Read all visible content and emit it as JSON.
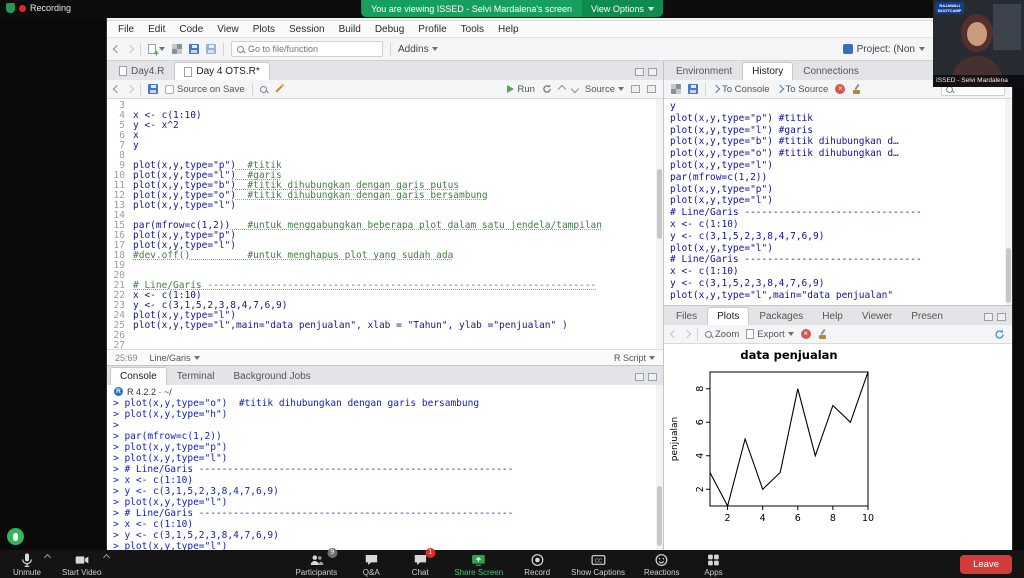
{
  "zoom": {
    "recording": "Recording",
    "banner_text": "You are viewing ISSED - Selvi Mardalena's screen",
    "view_options": "View Options",
    "view": "View",
    "webcam": {
      "label": "ISSED - Selvi Mardalena",
      "logo_line1": "RAJAWALI",
      "logo_line2": "BOOTCAMP"
    },
    "toolbar": {
      "items": [
        {
          "id": "unmute",
          "label": "Unmute",
          "icon": "mic",
          "group": "left",
          "menu_caret": true,
          "badge": ""
        },
        {
          "id": "start-video",
          "label": "Start Video",
          "icon": "video",
          "group": "left",
          "menu_caret": true,
          "badge": ""
        },
        {
          "id": "participants",
          "label": "Participants",
          "icon": "participants",
          "group": "center",
          "badge": "9"
        },
        {
          "id": "qa",
          "label": "Q&A",
          "icon": "qa",
          "group": "center",
          "badge": ""
        },
        {
          "id": "chat",
          "label": "Chat",
          "icon": "chat",
          "group": "center",
          "badge": "1"
        },
        {
          "id": "share-screen",
          "label": "Share Screen",
          "icon": "share",
          "group": "center",
          "accent": true,
          "badge": ""
        },
        {
          "id": "record",
          "label": "Record",
          "icon": "record",
          "group": "center",
          "badge": ""
        },
        {
          "id": "show-captions",
          "label": "Show Captions",
          "icon": "cc",
          "group": "center",
          "badge": ""
        },
        {
          "id": "reactions",
          "label": "Reactions",
          "icon": "reactions",
          "group": "center",
          "badge": ""
        },
        {
          "id": "apps",
          "label": "Apps",
          "icon": "apps",
          "group": "center",
          "badge": ""
        }
      ],
      "leave": "Leave"
    }
  },
  "rstudio": {
    "title": "RStudio",
    "menu": [
      "File",
      "Edit",
      "Code",
      "View",
      "Plots",
      "Session",
      "Build",
      "Debug",
      "Profile",
      "Tools",
      "Help"
    ],
    "toolbar": {
      "goto": "Go to file/function",
      "addins": "Addins",
      "project": "Project: (Non"
    },
    "source": {
      "tabs": [
        {
          "label": "Day4.R",
          "active": false
        },
        {
          "label": "Day 4 OTS.R*",
          "active": true
        }
      ],
      "source_on_save": "Source on Save",
      "run": "Run",
      "source_btn": "Source",
      "status_left": "25:69",
      "status_scope": "Line/Garis",
      "status_type": "R Script",
      "lines": [
        {
          "n": 3,
          "segs": []
        },
        {
          "n": 4,
          "segs": [
            {
              "t": "code",
              "s": "x <- c(1:10)"
            }
          ]
        },
        {
          "n": 5,
          "segs": [
            {
              "t": "code",
              "s": "y <- x^2"
            }
          ]
        },
        {
          "n": 6,
          "segs": [
            {
              "t": "code",
              "s": "x"
            }
          ]
        },
        {
          "n": 7,
          "segs": [
            {
              "t": "code",
              "s": "y"
            }
          ]
        },
        {
          "n": 8,
          "segs": []
        },
        {
          "n": 9,
          "segs": [
            {
              "t": "code",
              "s": "plot(x,y,type=\"p\")"
            },
            {
              "t": "comment",
              "s": "  #titik"
            }
          ]
        },
        {
          "n": 10,
          "segs": [
            {
              "t": "code",
              "s": "plot(x,y,type=\"l\")"
            },
            {
              "t": "comment",
              "s": "  #garis"
            }
          ]
        },
        {
          "n": 11,
          "segs": [
            {
              "t": "code",
              "s": "plot(x,y,type=\"b\")"
            },
            {
              "t": "comment",
              "s": "  #titik dihubungkan dengan garis putus"
            }
          ]
        },
        {
          "n": 12,
          "segs": [
            {
              "t": "code",
              "s": "plot(x,y,type=\"o\")"
            },
            {
              "t": "comment",
              "s": "  #titik dihubungkan dengan garis bersambung"
            }
          ]
        },
        {
          "n": 13,
          "segs": [
            {
              "t": "code",
              "s": "plot(x,y,type=\"l\")"
            }
          ]
        },
        {
          "n": 14,
          "segs": []
        },
        {
          "n": 15,
          "segs": [
            {
              "t": "code",
              "s": "par(mfrow=c(1,2))"
            },
            {
              "t": "comment",
              "s": "   #untuk menggabungkan beberapa plot dalam satu jendela/tampilan"
            }
          ]
        },
        {
          "n": 16,
          "segs": [
            {
              "t": "code",
              "s": "plot(x,y,type=\"p\")"
            }
          ]
        },
        {
          "n": 17,
          "segs": [
            {
              "t": "code",
              "s": "plot(x,y,type=\"l\")"
            }
          ]
        },
        {
          "n": 18,
          "segs": [
            {
              "t": "comment",
              "s": "#dev.off()          #untuk menghapus plot yang sudah ada"
            }
          ]
        },
        {
          "n": 19,
          "segs": []
        },
        {
          "n": 20,
          "segs": []
        },
        {
          "n": 21,
          "segs": [
            {
              "t": "comment",
              "s": "# Line/Garis --------------------------------------------------------------------"
            }
          ]
        },
        {
          "n": 22,
          "segs": [
            {
              "t": "code",
              "s": "x <- c(1:10)"
            }
          ]
        },
        {
          "n": 23,
          "segs": [
            {
              "t": "code",
              "s": "y <- c(3,1,5,2,3,8,4,7,6,9)"
            }
          ]
        },
        {
          "n": 24,
          "segs": [
            {
              "t": "code",
              "s": "plot(x,y,type=\"l\")"
            }
          ]
        },
        {
          "n": 25,
          "segs": [
            {
              "t": "code",
              "s": "plot(x,y,type=\"l\",main=\"data penjualan\", xlab = \"Tahun\", ylab =\"penjualan\" )"
            }
          ]
        },
        {
          "n": 26,
          "segs": []
        },
        {
          "n": 27,
          "segs": []
        }
      ]
    },
    "console": {
      "tabs": [
        {
          "label": "Console",
          "active": true
        },
        {
          "label": "Terminal",
          "active": false
        },
        {
          "label": "Background Jobs",
          "active": false
        }
      ],
      "header": "R 4.2.2 · ~/",
      "lines": [
        "> plot(x,y,type=\"o\")  #titik dihubungkan dengan garis bersambung",
        "> plot(x,y,type=\"h\")",
        ">",
        "> par(mfrow=c(1,2))",
        "> plot(x,y,type=\"p\")",
        "> plot(x,y,type=\"l\")",
        "> # Line/Garis -------------------------------------------------------",
        "> x <- c(1:10)",
        "> y <- c(3,1,5,2,3,8,4,7,6,9)",
        "> plot(x,y,type=\"l\")",
        "> # Line/Garis -------------------------------------------------------",
        "> x <- c(1:10)",
        "> y <- c(3,1,5,2,3,8,4,7,6,9)",
        "> plot(x,y,type=\"l\")"
      ]
    },
    "environment": {
      "tabs": [
        {
          "label": "Environment",
          "active": false
        },
        {
          "label": "History",
          "active": true
        },
        {
          "label": "Connections",
          "active": false
        }
      ],
      "to_console": "To Console",
      "to_source": "To Source",
      "history": [
        "y",
        "plot(x,y,type=\"p\") #titik",
        "plot(x,y,type=\"l\") #garis",
        "plot(x,y,type=\"b\") #titik dihubungkan d…",
        "plot(x,y,type=\"o\") #titik dihubungkan d…",
        "plot(x,y,type=\"l\")",
        "par(mfrow=c(1,2))",
        "plot(x,y,type=\"p\")",
        "plot(x,y,type=\"l\")",
        "# Line/Garis -------------------------------",
        "x <- c(1:10)",
        "y <- c(3,1,5,2,3,8,4,7,6,9)",
        "plot(x,y,type=\"l\")",
        "# Line/Garis -------------------------------",
        "x <- c(1:10)",
        "y <- c(3,1,5,2,3,8,4,7,6,9)",
        "plot(x,y,type=\"l\",main=\"data penjualan\""
      ]
    },
    "plots": {
      "tabs": [
        {
          "label": "Files",
          "active": false
        },
        {
          "label": "Plots",
          "active": true
        },
        {
          "label": "Packages",
          "active": false
        },
        {
          "label": "Help",
          "active": false
        },
        {
          "label": "Viewer",
          "active": false
        },
        {
          "label": "Presen",
          "active": false
        }
      ],
      "zoom": "Zoom",
      "export": "Export"
    }
  },
  "chart_data": {
    "type": "line",
    "title": "data penjualan",
    "x": [
      1,
      2,
      3,
      4,
      5,
      6,
      7,
      8,
      9,
      10
    ],
    "y": [
      3,
      1,
      5,
      2,
      3,
      8,
      4,
      7,
      6,
      9
    ],
    "xlabel": "",
    "ylabel": "penjualan",
    "x_ticks": [
      2,
      4,
      6,
      8,
      10
    ],
    "y_ticks": [
      2,
      4,
      6,
      8
    ],
    "xlim": [
      1,
      10
    ],
    "ylim": [
      1,
      9
    ],
    "grid": false,
    "line_color": "#000000"
  }
}
